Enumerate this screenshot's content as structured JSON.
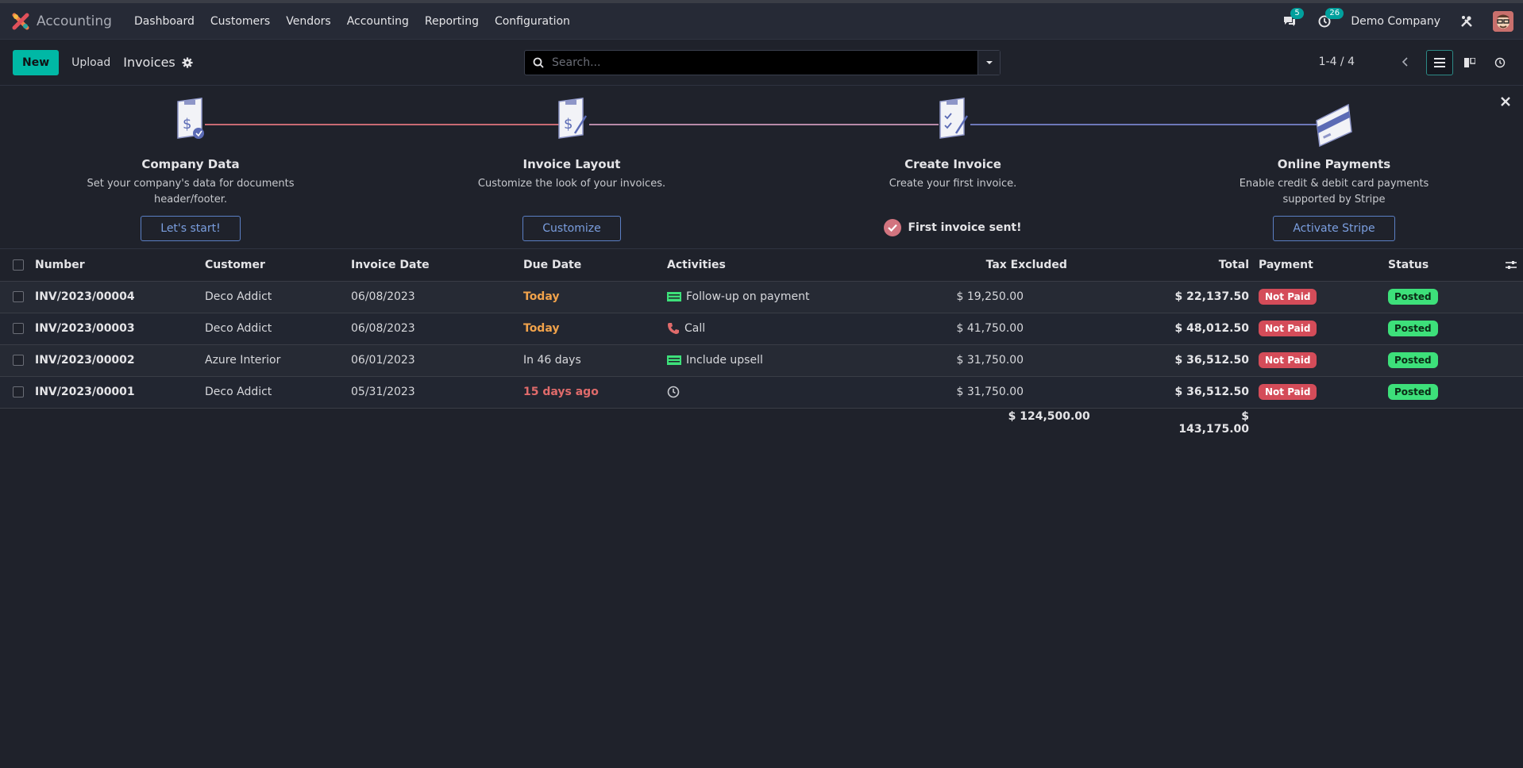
{
  "navbar": {
    "app_name": "Accounting",
    "menu": [
      "Dashboard",
      "Customers",
      "Vendors",
      "Accounting",
      "Reporting",
      "Configuration"
    ],
    "messages_count": "5",
    "activities_count": "26",
    "company": "Demo Company"
  },
  "control": {
    "new_label": "New",
    "upload_label": "Upload",
    "title": "Invoices",
    "search_placeholder": "Search...",
    "pager": "1-4 / 4"
  },
  "onboarding": {
    "steps": [
      {
        "title": "Company Data",
        "desc": "Set your company's data for documents header/footer.",
        "button": "Let's start!"
      },
      {
        "title": "Invoice Layout",
        "desc": "Customize the look of your invoices.",
        "button": "Customize"
      },
      {
        "title": "Create Invoice",
        "desc": "Create your first invoice.",
        "done": "First invoice sent!"
      },
      {
        "title": "Online Payments",
        "desc": "Enable credit & debit card payments supported by Stripe",
        "button": "Activate Stripe"
      }
    ]
  },
  "table": {
    "headers": {
      "number": "Number",
      "customer": "Customer",
      "invoice_date": "Invoice Date",
      "due_date": "Due Date",
      "activities": "Activities",
      "tax_excluded": "Tax Excluded",
      "total": "Total",
      "payment": "Payment",
      "status": "Status"
    },
    "rows": [
      {
        "number": "INV/2023/00004",
        "customer": "Deco Addict",
        "invoice_date": "06/08/2023",
        "due_date": "Today",
        "activity": "Follow-up on payment",
        "tax_excluded": "$ 19,250.00",
        "total": "$ 22,137.50",
        "payment": "Not Paid",
        "status": "Posted"
      },
      {
        "number": "INV/2023/00003",
        "customer": "Deco Addict",
        "invoice_date": "06/08/2023",
        "due_date": "Today",
        "activity": "Call",
        "tax_excluded": "$ 41,750.00",
        "total": "$ 48,012.50",
        "payment": "Not Paid",
        "status": "Posted"
      },
      {
        "number": "INV/2023/00002",
        "customer": "Azure Interior",
        "invoice_date": "06/01/2023",
        "due_date": "In 46 days",
        "activity": "Include upsell",
        "tax_excluded": "$ 31,750.00",
        "total": "$ 36,512.50",
        "payment": "Not Paid",
        "status": "Posted"
      },
      {
        "number": "INV/2023/00001",
        "customer": "Deco Addict",
        "invoice_date": "05/31/2023",
        "due_date": "15 days ago",
        "activity": "",
        "tax_excluded": "$ 31,750.00",
        "total": "$ 36,512.50",
        "payment": "Not Paid",
        "status": "Posted"
      }
    ],
    "totals": {
      "tax_excluded": "$ 124,500.00",
      "total": "$ 143,175.00"
    }
  }
}
